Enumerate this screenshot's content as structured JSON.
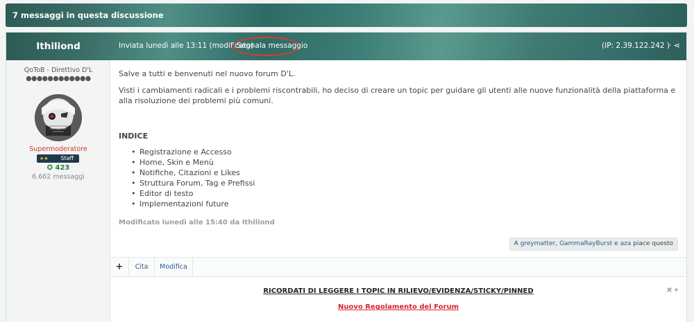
{
  "topic": {
    "count_label": "7 messaggi in questa discussione"
  },
  "post": {
    "author": "Ithiliond",
    "meta": "Inviata lunedì alle 13:11 (modificato)",
    "report_label": "Segnala messaggio",
    "ip": "(IP: 2.39.122.242 )",
    "share_icon": "share-icon",
    "author_info": {
      "rank": "QoToB - Direttivo D'L",
      "rank_dots": "●●●●●●●●●●●●",
      "group": "Supermoderatore",
      "badge_stars": "★★",
      "badge_label": "Staff",
      "reputation": "✪ 423",
      "messages": "6.662 messaggi"
    },
    "content": {
      "greeting": "Salve a tutti e benvenuti nel nuovo forum D'L.",
      "intro": "Visti i cambiamenti radicali e i problemi riscontrabili, ho deciso di creare un topic per guidare gli utenti alle nuove funzionalità della piattaforma e alla risoluzione dei problemi più comuni.",
      "index_title": "INDICE",
      "index_items": [
        "Registrazione e Accesso",
        "Home, Skin e Menù",
        "Notifiche, Citazioni e Likes",
        "Struttura Forum, Tag e Prefissi",
        "Editor di testo",
        "Implementazioni future"
      ],
      "edited": "Modificato lunedì alle 15:40 da Ithiliond"
    },
    "likes": {
      "prefix": "A",
      "user1": "greymatter",
      "sep": ",",
      "user2": "GammaRayBurst",
      "conj": "e",
      "user3": "aza",
      "suffix": "piace questo"
    },
    "actions": {
      "plus": "+",
      "quote": "Cita",
      "edit": "Modifica"
    }
  },
  "notice": {
    "line1": "RICORDATI DI LEGGERE I TOPIC IN RILIEVO/EVIDENZA/STICKY/PINNED",
    "line2": "Nuovo Regolamento del Forum",
    "close": "✖ ▾"
  },
  "colors": {
    "header_teal": "#3b6f68",
    "report_circle": "#e03a2c",
    "group_red": "#d6352b",
    "link_blue": "#2a5e8c"
  }
}
